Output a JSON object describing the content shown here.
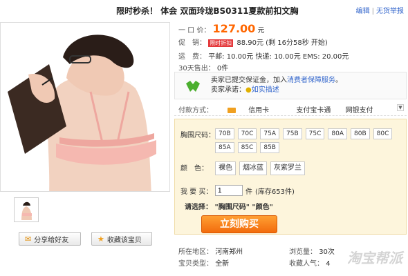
{
  "header": {
    "title": "限时秒杀！ 体会 双面玲珑BS0311夏款前扣文胸",
    "edit": "编辑",
    "sep": "|",
    "report": "无货举报"
  },
  "price": {
    "label": "一 口 价：",
    "value": "127.00",
    "unit": "元"
  },
  "promo": {
    "label": "促　销：",
    "tag": "限时折扣",
    "text": "88.90元 (剩 16分58秒 开始)"
  },
  "shipping": {
    "label": "运　费：",
    "text": "平邮: 10.00元 快递: 10.00元 EMS: 20.00元"
  },
  "sold": {
    "label": "30天售出：",
    "value": "0件"
  },
  "guarantee": {
    "line1_pre": "卖家已提交保证金，加入",
    "line1_link": "消费者保障服务",
    "line1_post": "。",
    "line2_pre": "卖家承诺：",
    "line2_link": "如实描述"
  },
  "payment": {
    "label": "付款方式：",
    "options": [
      "信用卡",
      "支付宝卡通",
      "网银支付"
    ]
  },
  "selection": {
    "size_label": "胸围尺码：",
    "sizes": [
      "70B",
      "70C",
      "75A",
      "75B",
      "75C",
      "80A",
      "80B",
      "80C",
      "85A",
      "85C",
      "85B"
    ],
    "color_label": "颜　色：",
    "colors": [
      "裸色",
      "烟冰蓝",
      "灰紫罗兰"
    ],
    "qty_label": "我 要 买：",
    "qty_value": "1",
    "qty_unit": "件",
    "stock": "(库存653件)",
    "prompt_label": "请选择：",
    "prompt_text": "\"胸围尺码\" \"颜色\"",
    "buy_button": "立刻购买"
  },
  "actions": {
    "share": "分享给好友",
    "favorite": "收藏该宝贝"
  },
  "meta": {
    "location_label": "所在地区：",
    "location": "河南郑州",
    "type_label": "宝贝类型：",
    "type": "全新",
    "views_label": "浏览量：",
    "views": "30次",
    "fav_label": "收藏人气：",
    "fav": "4"
  },
  "watermark": "淘宝帮派"
}
